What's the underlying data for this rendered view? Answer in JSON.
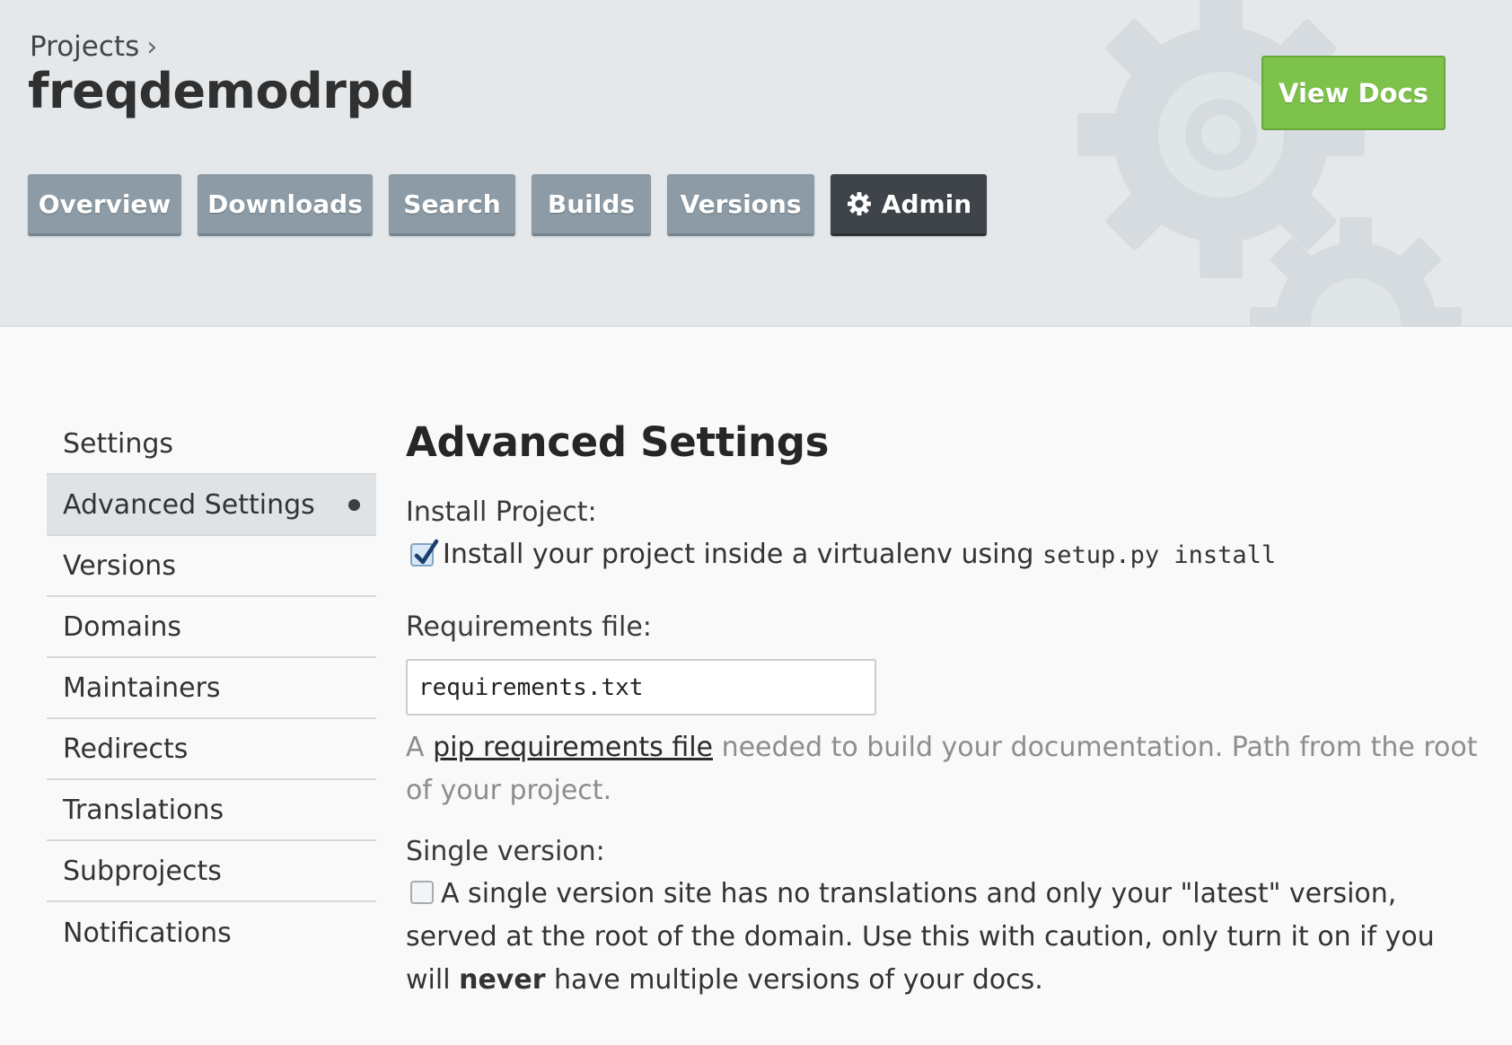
{
  "header": {
    "breadcrumb": "Projects",
    "breadcrumb_separator": "›",
    "project_name": "freqdemodrpd",
    "view_docs_label": "View Docs",
    "tabs": [
      {
        "label": "Overview"
      },
      {
        "label": "Downloads"
      },
      {
        "label": "Search"
      },
      {
        "label": "Builds"
      },
      {
        "label": "Versions"
      },
      {
        "label": "Admin",
        "icon": "gear-icon",
        "active": true
      }
    ]
  },
  "sidebar": {
    "items": [
      {
        "label": "Settings"
      },
      {
        "label": "Advanced Settings",
        "active": true
      },
      {
        "label": "Versions"
      },
      {
        "label": "Domains"
      },
      {
        "label": "Maintainers"
      },
      {
        "label": "Redirects"
      },
      {
        "label": "Translations"
      },
      {
        "label": "Subprojects"
      },
      {
        "label": "Notifications"
      }
    ]
  },
  "main": {
    "title": "Advanced Settings",
    "install_project": {
      "label": "Install Project:",
      "checked": true,
      "text_before": "Install your project inside a virtualenv using",
      "code": "setup.py install"
    },
    "requirements": {
      "label": "Requirements file:",
      "value": "requirements.txt",
      "help_prefix": "A",
      "help_link": "pip requirements file",
      "help_suffix": "needed to build your documentation. Path from the root of your project."
    },
    "single_version": {
      "label": "Single version:",
      "checked": false,
      "text_before": "A single version site has no translations and only your \"latest\" version, served at the root of the domain. Use this with caution, only turn it on if you will",
      "text_bold": "never",
      "text_after": "have multiple versions of your docs."
    }
  },
  "colors": {
    "header_bg": "#e4e8eb",
    "tab_bg": "#8c9ba5",
    "tab_active_bg": "#3e4449",
    "view_docs_bg": "#7dc34b",
    "sidebar_active_bg": "#dfe3e6"
  }
}
